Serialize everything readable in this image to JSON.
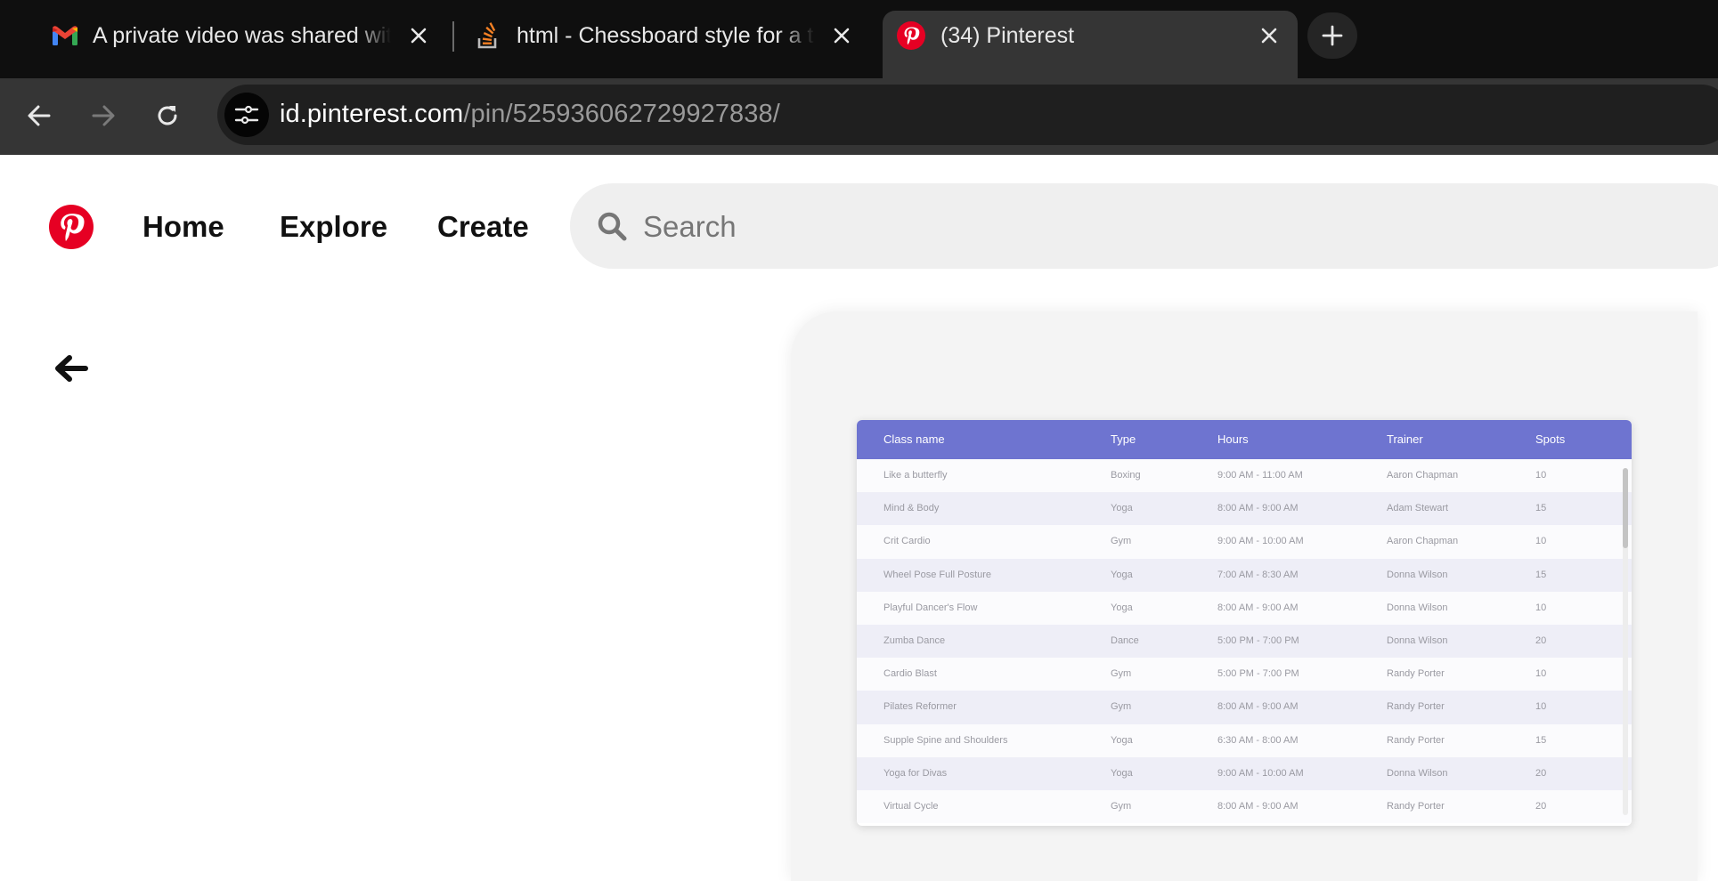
{
  "browser": {
    "tabs": [
      {
        "title": "A private video was shared with you",
        "favicon": "gmail-icon",
        "active": false
      },
      {
        "title": "html - Chessboard style for a table",
        "favicon": "stackoverflow-icon",
        "active": false
      },
      {
        "title": "(34) Pinterest",
        "favicon": "pinterest-icon",
        "active": true
      }
    ],
    "url_host": "id.pinterest.com",
    "url_path": "/pin/525936062729927838/"
  },
  "header": {
    "nav": [
      "Home",
      "Explore",
      "Create"
    ],
    "search_placeholder": "Search"
  },
  "pin": {
    "table": {
      "headers": [
        "Class name",
        "Type",
        "Hours",
        "Trainer",
        "Spots"
      ],
      "rows": [
        [
          "Like a butterfly",
          "Boxing",
          "9:00 AM - 11:00 AM",
          "Aaron Chapman",
          "10"
        ],
        [
          "Mind & Body",
          "Yoga",
          "8:00 AM - 9:00 AM",
          "Adam Stewart",
          "15"
        ],
        [
          "Crit Cardio",
          "Gym",
          "9:00 AM - 10:00 AM",
          "Aaron Chapman",
          "10"
        ],
        [
          "Wheel Pose Full Posture",
          "Yoga",
          "7:00 AM - 8:30 AM",
          "Donna Wilson",
          "15"
        ],
        [
          "Playful Dancer's Flow",
          "Yoga",
          "8:00 AM - 9:00 AM",
          "Donna Wilson",
          "10"
        ],
        [
          "Zumba Dance",
          "Dance",
          "5:00 PM - 7:00 PM",
          "Donna Wilson",
          "20"
        ],
        [
          "Cardio Blast",
          "Gym",
          "5:00 PM - 7:00 PM",
          "Randy Porter",
          "10"
        ],
        [
          "Pilates Reformer",
          "Gym",
          "8:00 AM - 9:00 AM",
          "Randy Porter",
          "10"
        ],
        [
          "Supple Spine and Shoulders",
          "Yoga",
          "6:30 AM - 8:00 AM",
          "Randy Porter",
          "15"
        ],
        [
          "Yoga for Divas",
          "Yoga",
          "9:00 AM - 10:00 AM",
          "Donna Wilson",
          "20"
        ],
        [
          "Virtual Cycle",
          "Gym",
          "8:00 AM - 9:00 AM",
          "Randy Porter",
          "20"
        ]
      ]
    }
  },
  "colors": {
    "pinterest_red": "#e60023",
    "table_header": "#6e74d0"
  }
}
